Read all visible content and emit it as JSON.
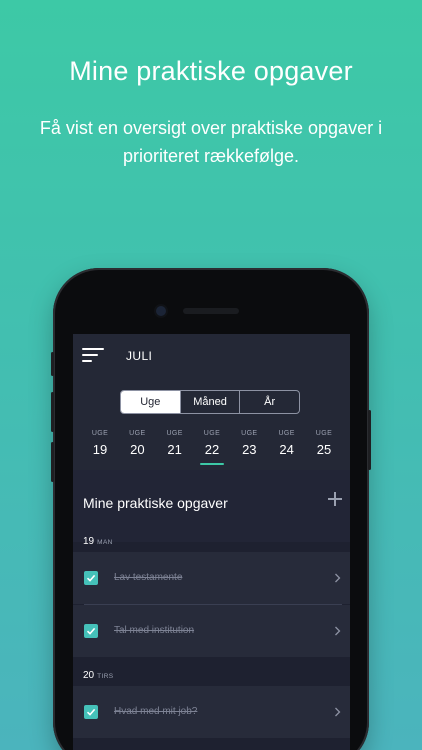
{
  "promo": {
    "title": "Mine praktiske opgaver",
    "subtitle": "Få vist en oversigt over praktiske opgaver i prioriteret rækkefølge."
  },
  "header": {
    "menu_icon": "hamburger-menu-icon",
    "month": "JULI"
  },
  "period_tabs": [
    {
      "label": "Uge",
      "active": true
    },
    {
      "label": "Måned",
      "active": false
    },
    {
      "label": "År",
      "active": false
    }
  ],
  "weeks": [
    {
      "label": "UGE",
      "number": "19"
    },
    {
      "label": "UGE",
      "number": "20"
    },
    {
      "label": "UGE",
      "number": "21"
    },
    {
      "label": "UGE",
      "number": "22",
      "active": true
    },
    {
      "label": "UGE",
      "number": "23"
    },
    {
      "label": "UGE",
      "number": "24"
    },
    {
      "label": "UGE",
      "number": "25"
    }
  ],
  "tasks_section": {
    "title": "Mine praktiske opgaver",
    "add_icon": "plus-icon",
    "days": [
      {
        "day": "19",
        "dayname": "MAN",
        "tasks": [
          {
            "text": "Lav testamente",
            "done": true
          },
          {
            "text": "Tal med institution",
            "done": true
          }
        ]
      },
      {
        "day": "20",
        "dayname": "TIRS",
        "tasks": [
          {
            "text": "Hvad med mit job?",
            "done": true
          }
        ]
      }
    ]
  },
  "colors": {
    "accent": "#3dc9a6",
    "checkbox": "#45c1b9",
    "app_bg": "#232633"
  }
}
